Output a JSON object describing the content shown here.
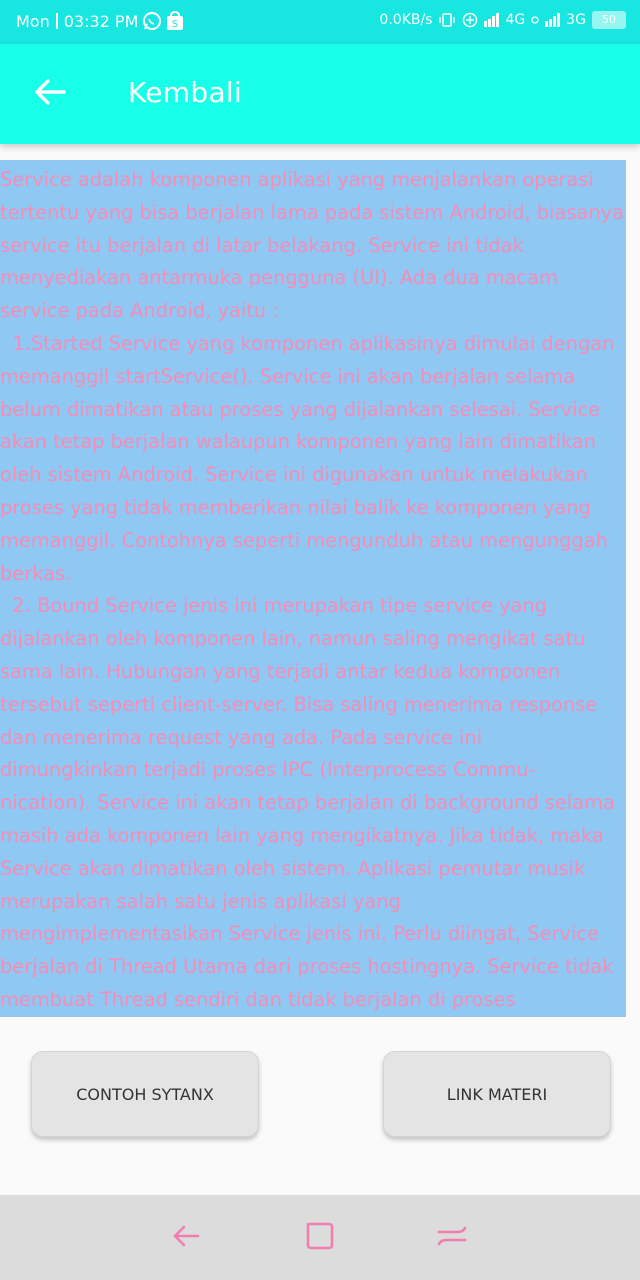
{
  "status_bar": {
    "day": "Mon",
    "time": "03:32 PM",
    "net_speed": "0.0KB/s",
    "network_1": "4G",
    "network_2": "3G",
    "battery": "50",
    "icons": [
      "whatsapp-icon",
      "shopping-bag-icon",
      "vibrate-icon",
      "data-saver-icon",
      "signal-icon",
      "signal-icon"
    ]
  },
  "app_bar": {
    "back_icon": "arrow-left-icon",
    "title": "Kembali",
    "color": "#18ffe9"
  },
  "content": {
    "text": "Service adalah komponen aplikasi yang menjalankan operasi tertentu yang bisa berjalan lama pada sistem Android, biasanya service itu berjalan di latar belakang. Service ini tidak menyediakan antarmuka pengguna (UI). Ada dua macam service pada Android, yaitu :\n  1.Started Service yang komponen aplikasinya dimulai dengan memanggil startService(). Service ini akan berjalan selama belum dimatikan atau proses yang dijalankan selesai. Service akan tetap berjalan walaupun komponen yang lain dimatikan oleh sistem Android. Service ini digunakan untuk melakukan proses yang tidak memberikan nilai balik ke komponen yang memanggil. Contohnya seperti mengunduh atau mengunggah berkas.\n  2. Bound Service jenis ini merupakan tipe service yang dijalankan oleh komponen lain, namun saling mengikat satu sama lain. Hubungan yang terjadi antar kedua komponen tersebut seperti client-server. Bisa saling menerima response dan menerima request yang ada. Pada service ini dimungkinkan terjadi proses IPC (Interprocess Commu-nication). Service ini akan tetap berjalan di background selama masih ada komponen lain yang mengikatnya. Jika tidak, maka Service akan dimatikan oleh sistem. Aplikasi pemutar musik merupakan salah satu jenis aplikasi yang mengimplementasikan Service jenis ini. Perlu diingat, Service berjalan di Thread Utama dari proses hostingnya. Service tidak membuat Thread sendiri dan tidak berjalan di proses",
    "background_color": "#8ec8f3",
    "text_color": "#f58db6"
  },
  "buttons": {
    "left_label": "CONTOH SYTANX",
    "right_label": "LINK MATERI"
  },
  "nav_bar": {
    "icons": [
      "back-icon",
      "home-icon",
      "recent-apps-icon"
    ],
    "icon_color": "#f07fb0"
  }
}
